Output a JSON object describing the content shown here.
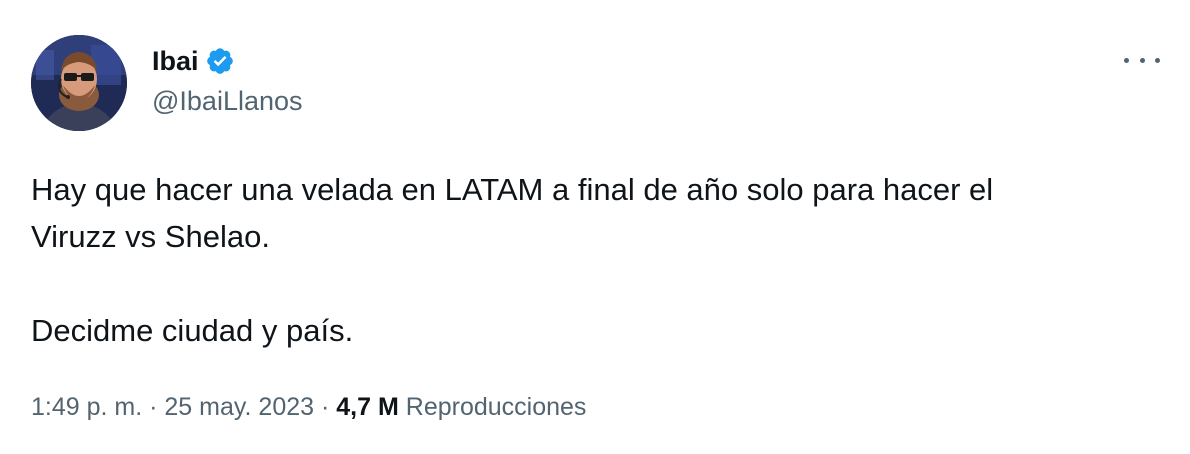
{
  "author": {
    "display_name": "Ibai",
    "handle": "@IbaiLlanos",
    "verified": true,
    "verified_color": "#1d9bf0"
  },
  "menu": {
    "icon": "more-horizontal-icon"
  },
  "tweet": {
    "paragraphs": [
      "Hay que hacer una velada en LATAM a final de año solo para hacer el",
      "Viruzz vs Shelao.",
      "Decidme ciudad y país."
    ]
  },
  "meta": {
    "time": "1:49 p. m.",
    "separator": "·",
    "date": "25 may. 2023",
    "views_count": "4,7 M",
    "views_label": "Reproducciones"
  },
  "colors": {
    "text_primary": "#0f1419",
    "text_secondary": "#536471",
    "background": "#ffffff"
  }
}
